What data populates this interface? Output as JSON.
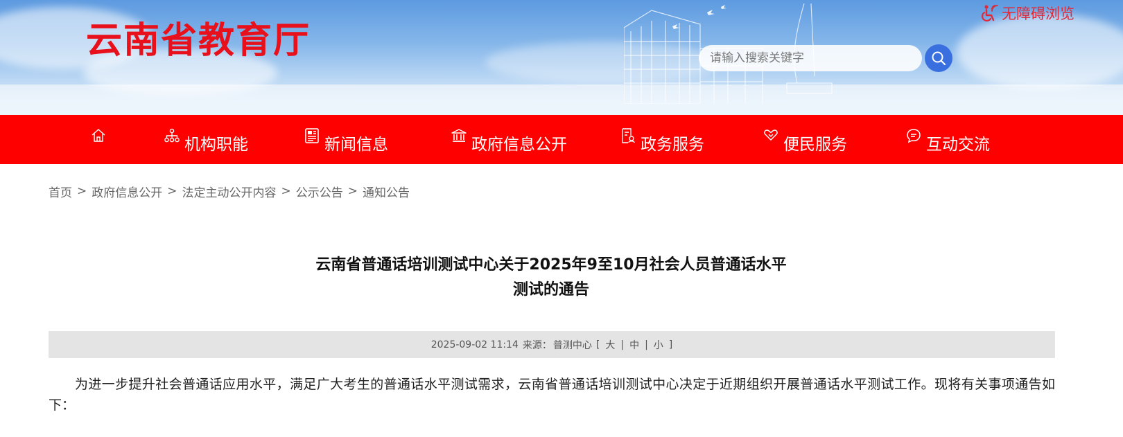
{
  "header": {
    "site_title": "云南省教育厅",
    "accessibility_label": "无障碍浏览",
    "search": {
      "placeholder": "请输入搜索关键字",
      "value": ""
    }
  },
  "nav": {
    "items": [
      {
        "label": "",
        "icon": "home-icon"
      },
      {
        "label": "机构职能",
        "icon": "org-chart-icon"
      },
      {
        "label": "新闻信息",
        "icon": "newspaper-icon"
      },
      {
        "label": "政府信息公开",
        "icon": "government-building-icon"
      },
      {
        "label": "政务服务",
        "icon": "service-document-icon"
      },
      {
        "label": "便民服务",
        "icon": "heart-hands-icon"
      },
      {
        "label": "互动交流",
        "icon": "chat-bubble-icon"
      }
    ]
  },
  "breadcrumb": {
    "items": [
      "首页",
      "政府信息公开",
      "法定主动公开内容",
      "公示公告",
      "通知公告"
    ],
    "separator": ">"
  },
  "article": {
    "title_line1": "云南省普通话培训测试中心关于2025年9至10月社会人员普通话水平",
    "title_line2": "测试的通告",
    "date": "2025-09-02 11:14",
    "source_label": "来源：",
    "source": "普测中心",
    "bracket_open": "[",
    "bracket_close": "]",
    "font_sizes": [
      "大",
      "中",
      "小"
    ],
    "divider": "|",
    "body": "为进一步提升社会普通话应用水平，满足广大考生的普通话水平测试需求，云南省普通话培训测试中心决定于近期组织开展普通话水平测试工作。现将有关事项通告如下："
  },
  "colors": {
    "brand_red": "#ff0000",
    "title_red": "#e8101a",
    "search_button_blue": "#3a6fe0",
    "meta_bar_gray": "#e4e4e4"
  }
}
